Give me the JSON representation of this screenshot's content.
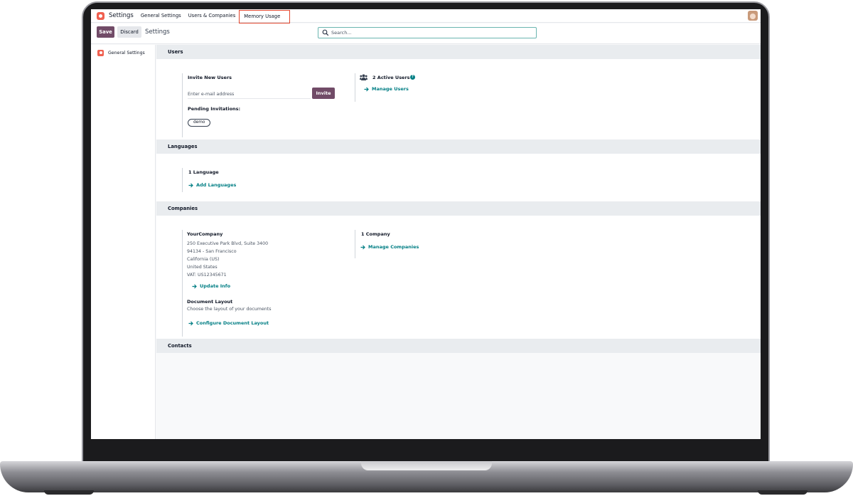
{
  "topnav": {
    "app_name": "Settings",
    "items": [
      "General Settings",
      "Users & Companies",
      "Memory Usage"
    ]
  },
  "control_panel": {
    "save_label": "Save",
    "discard_label": "Discard",
    "title": "Settings",
    "search_placeholder": "Search..."
  },
  "sidebar": {
    "items": [
      {
        "label": "General Settings"
      }
    ]
  },
  "sections": {
    "users": {
      "title": "Users",
      "invite_label": "Invite New Users",
      "email_placeholder": "Enter e-mail address",
      "invite_button": "Invite",
      "pending_label": "Pending Invitations:",
      "pending_tags": [
        "demo"
      ],
      "active_users": "2 Active Users",
      "manage_users": "Manage Users"
    },
    "languages": {
      "title": "Languages",
      "count_label": "1 Language",
      "add_link": "Add Languages"
    },
    "companies": {
      "title": "Companies",
      "company_name": "YourCompany",
      "address_lines": [
        "250 Executive Park Blvd, Suite 3400",
        "94134 - San Francisco",
        "California (US)",
        "United States",
        "VAT:  US12345671"
      ],
      "update_link": "Update Info",
      "doc_layout_label": "Document Layout",
      "doc_layout_desc": "Choose the layout of your documents",
      "configure_link": "Configure Document Layout",
      "count_label": "1 Company",
      "manage_link": "Manage Companies"
    },
    "contacts": {
      "title": "Contacts"
    }
  },
  "colors": {
    "brand_primary": "#714b67",
    "link": "#017e84",
    "highlight_box": "#e0452d",
    "app_icon": "#f06050"
  }
}
